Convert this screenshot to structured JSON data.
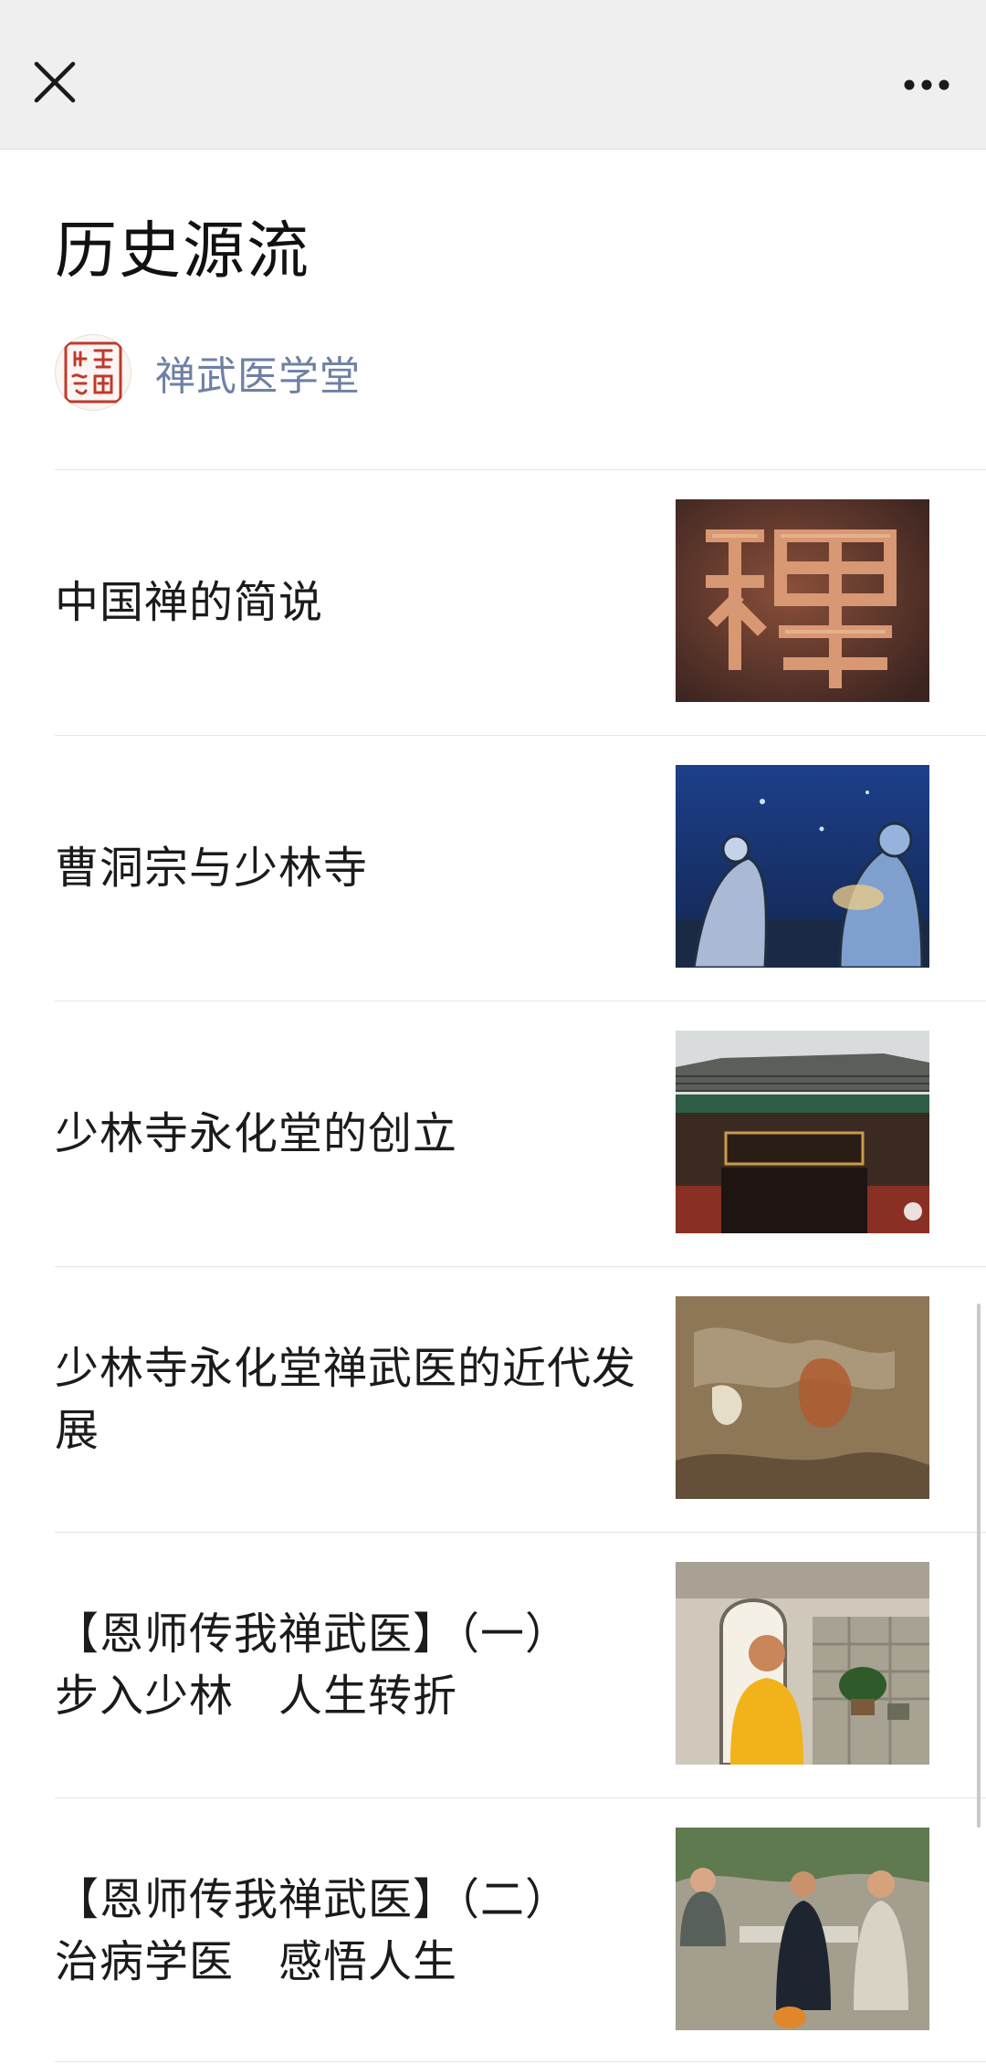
{
  "page": {
    "title": "历史源流"
  },
  "author": {
    "name": "禅武医学堂",
    "avatar_icon": "seal-stamp-avatar",
    "avatar_color": "#c0392b"
  },
  "toolbar": {
    "close_icon": "close-icon",
    "more_icon": "more-icon"
  },
  "articles": [
    {
      "title": "中国禅的简说",
      "thumbnail": "calligraphy-chan-character"
    },
    {
      "title": "曹洞宗与少林寺",
      "thumbnail": "illustrated-monks-night"
    },
    {
      "title": "少林寺永化堂的创立",
      "thumbnail": "temple-gate-roof"
    },
    {
      "title": "少林寺永化堂禅武医的近代发展",
      "thumbnail": "ancient-mural"
    },
    {
      "title": "【恩师传我禅武医】（一）\n步入少林　人生转折",
      "thumbnail": "monk-in-yellow-robe"
    },
    {
      "title": "【恩师传我禅武医】（二）\n治病学医　感悟人生",
      "thumbnail": "monks-at-stone-table"
    }
  ],
  "colors": {
    "topbar_bg": "#efefef",
    "author_link": "#6f80a3",
    "divider": "#e6e6e6"
  }
}
